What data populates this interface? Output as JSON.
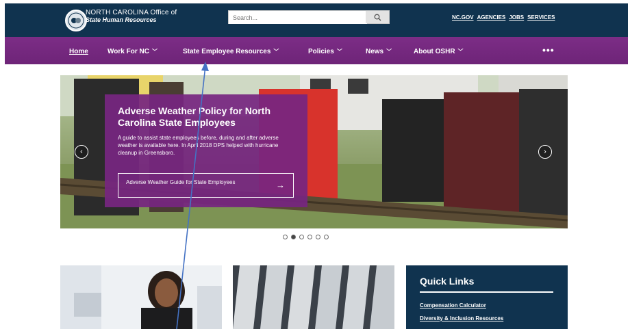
{
  "header": {
    "org_line1": "NORTH CAROLINA Office of",
    "org_line2": "State Human Resources",
    "search_placeholder": "Search...",
    "top_links": [
      "NC.GOV",
      "AGENCIES",
      "JOBS",
      "SERVICES"
    ]
  },
  "nav": {
    "items": [
      "Home",
      "Work For NC",
      "State Employee Resources",
      "Policies",
      "News",
      "About OSHR"
    ],
    "more": "•••"
  },
  "hero": {
    "title": "Adverse Weather Policy for North Carolina State Employees",
    "description": "A guide to assist state employees before, during and after adverse weather is available here. In April 2018 DPS helped with hurricane cleanup in Greensboro.",
    "button_label": "Adverse Weather Guide for State Employees",
    "button_arrow": "→",
    "prev": "‹",
    "next": "›",
    "slide_count": 6,
    "active_slide": 2
  },
  "quick_links": {
    "title": "Quick Links",
    "links": [
      "Compensation Calculator",
      "Diversity & Inclusion Resources"
    ]
  },
  "colors": {
    "header_bg": "#10334f",
    "nav_bg": "#6e2478",
    "card_bg": "#762680",
    "annotation": "#4472c4"
  }
}
